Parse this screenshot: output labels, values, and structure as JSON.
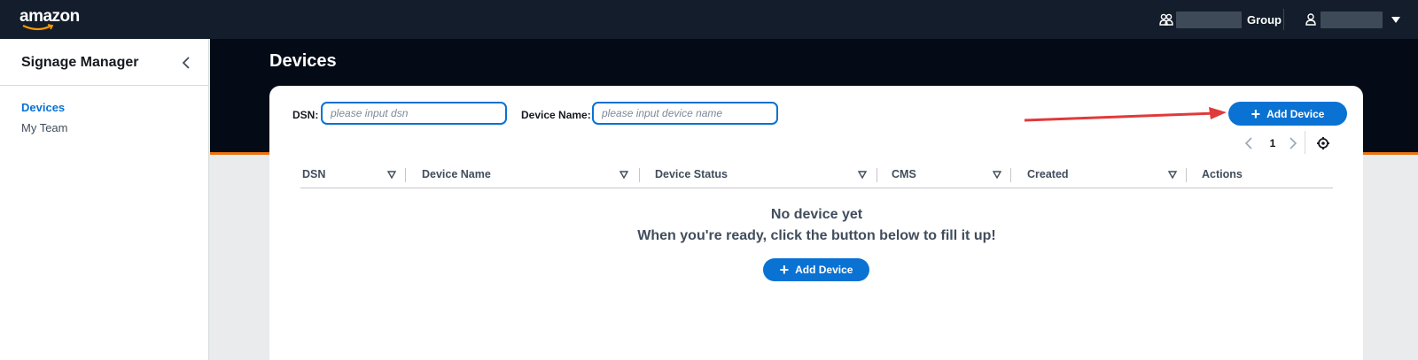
{
  "topbar": {
    "logo": "amazon",
    "group_label": "Group"
  },
  "sidebar": {
    "title": "Signage Manager",
    "items": [
      {
        "label": "Devices",
        "active": true
      },
      {
        "label": "My Team",
        "active": false
      }
    ]
  },
  "page": {
    "title": "Devices"
  },
  "filters": {
    "dsn_label": "DSN:",
    "dsn_placeholder": "please input dsn",
    "name_label": "Device Name:",
    "name_placeholder": "please input device name"
  },
  "actions": {
    "add_device_label": "Add Device"
  },
  "pagination": {
    "current_page": "1"
  },
  "table": {
    "columns": [
      "DSN",
      "Device Name",
      "Device Status",
      "CMS",
      "Created",
      "Actions"
    ]
  },
  "empty_state": {
    "title": "No device yet",
    "subtitle": "When you're ready, click the button below to fill it up!",
    "button_label": "Add Device"
  },
  "colors": {
    "accent": "#0972d3",
    "topbar": "#131d2b",
    "hero": "#040b17",
    "orange": "#ec7211",
    "annotation_arrow": "#e03a3a"
  },
  "icons": {
    "group": "group-icon",
    "user": "user-icon",
    "collapse": "chevron-left-icon",
    "plus": "plus-icon",
    "settings": "gear-icon"
  }
}
